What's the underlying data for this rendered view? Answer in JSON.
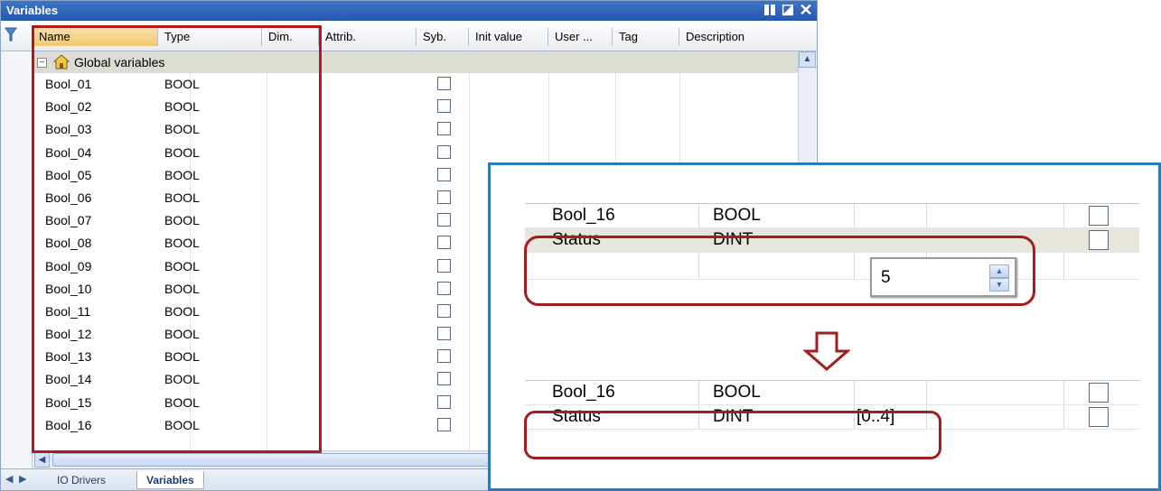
{
  "window": {
    "title": "Variables"
  },
  "columns": [
    "Name",
    "Type",
    "Dim.",
    "Attrib.",
    "Syb.",
    "Init value",
    "User ...",
    "Tag",
    "Description"
  ],
  "group": {
    "toggle": "⊟",
    "label": "Global variables"
  },
  "variables": [
    {
      "name": "Bool_01",
      "type": "BOOL"
    },
    {
      "name": "Bool_02",
      "type": "BOOL"
    },
    {
      "name": "Bool_03",
      "type": "BOOL"
    },
    {
      "name": "Bool_04",
      "type": "BOOL"
    },
    {
      "name": "Bool_05",
      "type": "BOOL"
    },
    {
      "name": "Bool_06",
      "type": "BOOL"
    },
    {
      "name": "Bool_07",
      "type": "BOOL"
    },
    {
      "name": "Bool_08",
      "type": "BOOL"
    },
    {
      "name": "Bool_09",
      "type": "BOOL"
    },
    {
      "name": "Bool_10",
      "type": "BOOL"
    },
    {
      "name": "Bool_11",
      "type": "BOOL"
    },
    {
      "name": "Bool_12",
      "type": "BOOL"
    },
    {
      "name": "Bool_13",
      "type": "BOOL"
    },
    {
      "name": "Bool_14",
      "type": "BOOL"
    },
    {
      "name": "Bool_15",
      "type": "BOOL"
    },
    {
      "name": "Bool_16",
      "type": "BOOL"
    }
  ],
  "tabs": [
    {
      "label": "IO Drivers",
      "active": false
    },
    {
      "label": "Variables",
      "active": true
    }
  ],
  "zoom": {
    "before": {
      "row1": {
        "name": "Bool_16",
        "type": "BOOL"
      },
      "row2": {
        "name": "Status",
        "type": "DINT"
      },
      "spin_value": "5"
    },
    "after": {
      "row1": {
        "name": "Bool_16",
        "type": "BOOL"
      },
      "row2": {
        "name": "Status",
        "type": "DINT",
        "dim": "[0..4]"
      }
    }
  },
  "colors": {
    "highlight_red": "#b01a1a",
    "panel_border_blue": "#2c7bb9",
    "title_blue": "#2f64b8",
    "name_header_orange": "#f2c770"
  }
}
